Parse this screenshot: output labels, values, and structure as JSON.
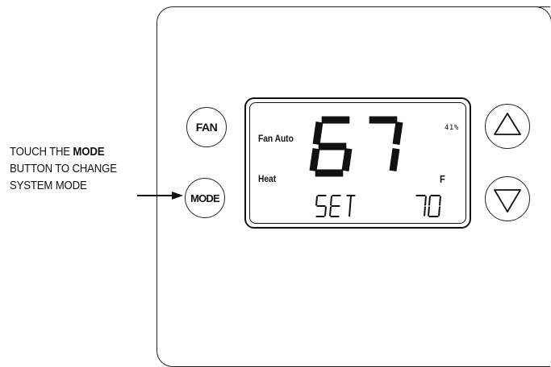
{
  "callout": {
    "line1_prefix": "TOUCH THE ",
    "line1_bold": "MODE",
    "line2": "BUTTON TO CHANGE",
    "line3": "SYSTEM MODE"
  },
  "buttons": {
    "fan_label": "FAN",
    "mode_label": "MODE",
    "up_icon": "triangle-up-icon",
    "down_icon": "triangle-down-icon"
  },
  "display": {
    "fan_status": "Fan Auto",
    "mode_status": "Heat",
    "current_temp": "67",
    "humidity": "41%",
    "unit": "F",
    "set_label": "SET",
    "set_temp": "70"
  },
  "colors": {
    "ink": "#111111",
    "background": "#ffffff"
  }
}
